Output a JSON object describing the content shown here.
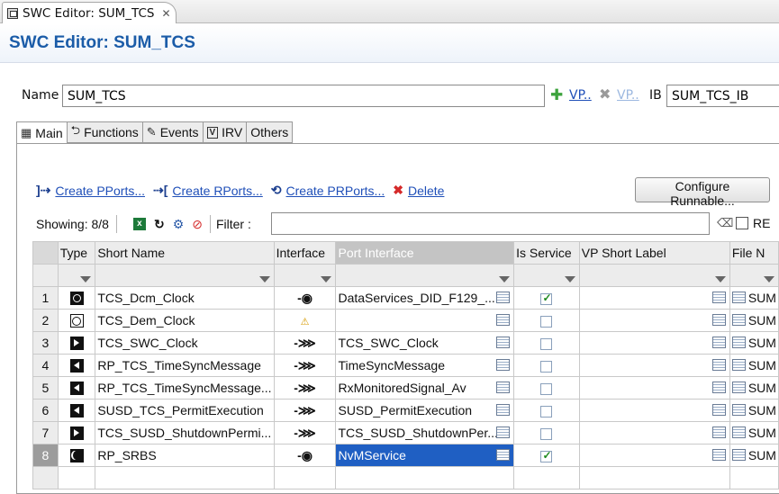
{
  "window": {
    "tab_title": "SWC Editor: SUM_TCS",
    "editor_title": "SWC Editor: SUM_TCS"
  },
  "name_row": {
    "name_label": "Name",
    "name_value": "SUM_TCS",
    "vp_add_label": "VP..",
    "vp_remove_label": "VP..",
    "ib_label": "IB",
    "ib_value": "SUM_TCS_IB"
  },
  "subtabs": [
    {
      "label": "Main",
      "icon": "main-icon"
    },
    {
      "label": "Functions",
      "icon": "functions-icon"
    },
    {
      "label": "Events",
      "icon": "events-icon"
    },
    {
      "label": "IRV",
      "icon": "irv-icon"
    },
    {
      "label": "Others",
      "icon": ""
    }
  ],
  "actions": {
    "create_pports": "Create PPorts...",
    "create_rports": "Create RPorts...",
    "create_prports": "Create PRPorts...",
    "delete": "Delete",
    "configure_runnable": "Configure Runnable..."
  },
  "toolbar": {
    "showing": "Showing: 8/8",
    "filter_label": "Filter :",
    "filter_value": "",
    "re_label": "RE"
  },
  "table": {
    "columns": [
      "Type",
      "Short Name",
      "Interface",
      "Port Interface",
      "Is Service",
      "VP Short Label",
      "File N"
    ],
    "rows": [
      {
        "num": "1",
        "type": "pr-port",
        "short_name": "TCS_Dcm_Clock",
        "interface": "client-server",
        "port_interface": "DataServices_DID_F129_...",
        "is_service": true,
        "file": "SUM"
      },
      {
        "num": "2",
        "type": "required-pr-port",
        "short_name": "TCS_Dem_Clock",
        "interface": "warning",
        "port_interface": "",
        "is_service": false,
        "file": "SUM"
      },
      {
        "num": "3",
        "type": "provided-port",
        "short_name": "TCS_SWC_Clock",
        "interface": "sender-receiver",
        "port_interface": "TCS_SWC_Clock",
        "is_service": false,
        "file": "SUM"
      },
      {
        "num": "4",
        "type": "required-port",
        "short_name": "RP_TCS_TimeSyncMessage",
        "interface": "sender-receiver",
        "port_interface": "TimeSyncMessage",
        "is_service": false,
        "file": "SUM"
      },
      {
        "num": "5",
        "type": "required-port",
        "short_name": "RP_TCS_TimeSyncMessage...",
        "interface": "sender-receiver",
        "port_interface": "RxMonitoredSignal_Av",
        "is_service": false,
        "file": "SUM"
      },
      {
        "num": "6",
        "type": "required-port",
        "short_name": "SUSD_TCS_PermitExecution",
        "interface": "sender-receiver",
        "port_interface": "SUSD_PermitExecution",
        "is_service": false,
        "file": "SUM"
      },
      {
        "num": "7",
        "type": "provided-port",
        "short_name": "TCS_SUSD_ShutdownPermi...",
        "interface": "sender-receiver",
        "port_interface": "TCS_SUSD_ShutdownPer...",
        "is_service": false,
        "file": "SUM"
      },
      {
        "num": "8",
        "type": "service-port",
        "short_name": "RP_SRBS",
        "interface": "client-server",
        "port_interface": "NvMService",
        "is_service": true,
        "file": "SUM",
        "selected": true
      }
    ]
  }
}
